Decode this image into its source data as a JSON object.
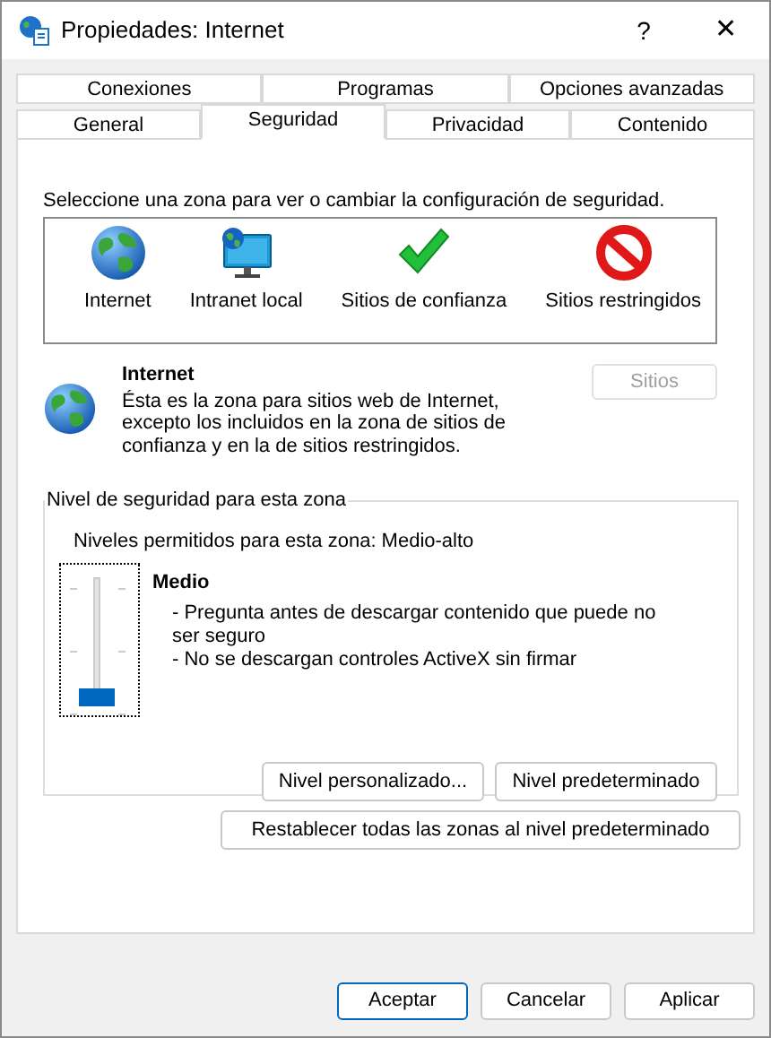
{
  "window": {
    "title": "Propiedades: Internet",
    "help": "?",
    "close": "✕"
  },
  "tabs": [
    [
      {
        "label": "Conexiones",
        "selected": false
      },
      {
        "label": "Programas",
        "selected": false
      },
      {
        "label": "Opciones avanzadas",
        "selected": false
      }
    ],
    [
      {
        "label": "General",
        "selected": false
      },
      {
        "label": "Seguridad",
        "selected": true
      },
      {
        "label": "Privacidad",
        "selected": false
      },
      {
        "label": "Contenido",
        "selected": false
      }
    ]
  ],
  "zone_prompt": "Seleccione una zona para ver o cambiar la configuración de seguridad.",
  "zones": [
    {
      "kind": "globe",
      "label": "Internet"
    },
    {
      "kind": "intranet",
      "label": "Intranet local"
    },
    {
      "kind": "trusted",
      "label": "Sitios de confianza"
    },
    {
      "kind": "restricted",
      "label": "Sitios restringidos"
    }
  ],
  "zone_info": {
    "kind": "globe",
    "title": "Internet",
    "description": "Ésta es la zona para sitios web de Internet, excepto los incluidos en la zona de sitios de confianza y en la de sitios restringidos.",
    "sites_button": {
      "label": "Sitios",
      "disabled": true
    }
  },
  "security_level": {
    "legend": "Nivel de seguridad para esta zona",
    "allowed": "Niveles permitidos para esta zona: Medio-alto",
    "level": 0,
    "name": "Medio",
    "details": [
      "- Pregunta antes de descargar contenido que puede no ser seguro",
      "- No se descargan controles ActiveX sin firmar"
    ],
    "buttons": [
      "Nivel personalizado...",
      "Nivel predeterminado"
    ]
  },
  "reset_button": "Restablecer todas las zonas al nivel predeterminado",
  "dialog_buttons": [
    {
      "label": "Aceptar",
      "default": true
    },
    {
      "label": "Cancelar",
      "default": false
    },
    {
      "label": "Aplicar",
      "default": false
    }
  ]
}
